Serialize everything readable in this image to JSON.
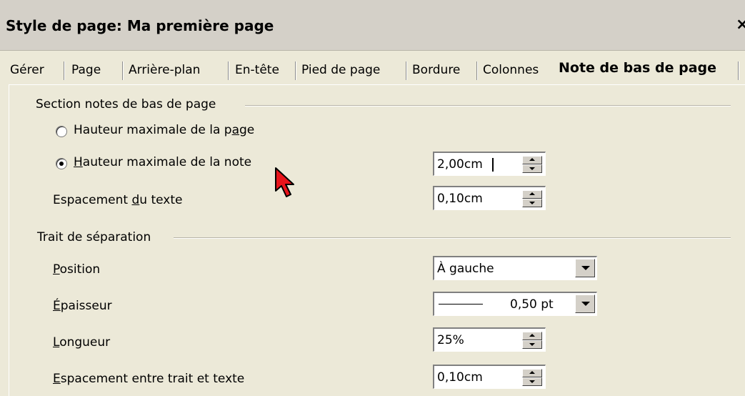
{
  "window": {
    "title": "Style de page: Ma première page",
    "close_label": "×"
  },
  "tabs": [
    {
      "label": "Gérer",
      "active": false
    },
    {
      "label": "Page",
      "active": false
    },
    {
      "label": "Arrière-plan",
      "active": false
    },
    {
      "label": "En-tête",
      "active": false
    },
    {
      "label": "Pied de page",
      "active": false
    },
    {
      "label": "Bordure",
      "active": false
    },
    {
      "label": "Colonnes",
      "active": false
    },
    {
      "label": "Note de bas de page",
      "active": true
    }
  ],
  "footnote_section": {
    "heading": "Section notes de bas de page",
    "radio_page_height": {
      "pre": "Hauteur maximale de la p",
      "acc": "a",
      "post": "ge",
      "checked": false
    },
    "radio_note_height": {
      "pre": "",
      "acc": "H",
      "post": "auteur maximale de la note",
      "checked": true
    },
    "note_height_value": "2,00cm",
    "text_spacing": {
      "pre": "Espacement ",
      "acc": "d",
      "post": "u texte"
    },
    "text_spacing_value": "0,10cm"
  },
  "separator_section": {
    "heading": "Trait de séparation",
    "position": {
      "pre": "",
      "acc": "P",
      "post": "osition"
    },
    "position_value": "À gauche",
    "thickness": {
      "pre": "",
      "acc": "É",
      "post": "paisseur"
    },
    "thickness_value": "0,50 pt",
    "length": {
      "pre": "",
      "acc": "L",
      "post": "ongueur"
    },
    "length_value": "25%",
    "line_spacing": {
      "pre": "",
      "acc": "E",
      "post": "spacement entre trait et texte"
    },
    "line_spacing_value": "0,10cm"
  },
  "colors": {
    "dialog_bg": "#ece9d8",
    "titlebar_bg": "#d4d0c8",
    "cursor": "#e8141b"
  }
}
